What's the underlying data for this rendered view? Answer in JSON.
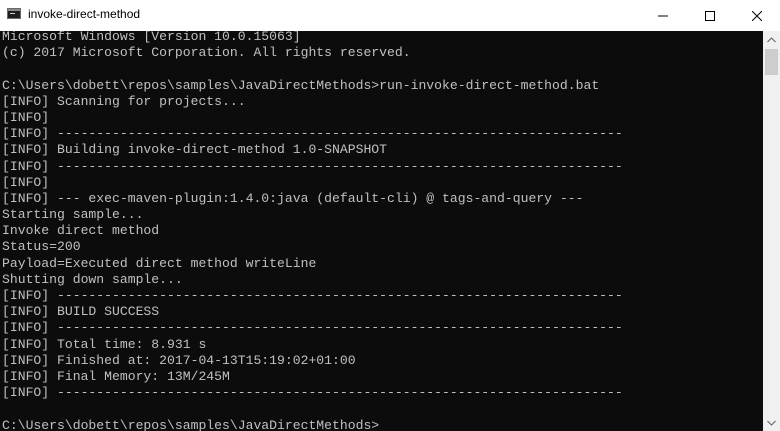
{
  "window": {
    "title": "invoke-direct-method",
    "icon": "console-icon",
    "controls": [
      "minimize-icon",
      "maximize-icon",
      "close-icon"
    ]
  },
  "console": {
    "lines": [
      "Microsoft Windows [Version 10.0.15063]",
      "(c) 2017 Microsoft Corporation. All rights reserved.",
      "",
      "C:\\Users\\dobett\\repos\\samples\\JavaDirectMethods>run-invoke-direct-method.bat",
      "[INFO] Scanning for projects...",
      "[INFO]",
      "[INFO] ------------------------------------------------------------------------",
      "[INFO] Building invoke-direct-method 1.0-SNAPSHOT",
      "[INFO] ------------------------------------------------------------------------",
      "[INFO]",
      "[INFO] --- exec-maven-plugin:1.4.0:java (default-cli) @ tags-and-query ---",
      "Starting sample...",
      "Invoke direct method",
      "Status=200",
      "Payload=Executed direct method writeLine",
      "Shutting down sample...",
      "[INFO] ------------------------------------------------------------------------",
      "[INFO] BUILD SUCCESS",
      "[INFO] ------------------------------------------------------------------------",
      "[INFO] Total time: 8.931 s",
      "[INFO] Finished at: 2017-04-13T15:19:02+01:00",
      "[INFO] Final Memory: 13M/245M",
      "[INFO] ------------------------------------------------------------------------",
      "",
      "C:\\Users\\dobett\\repos\\samples\\JavaDirectMethods>"
    ],
    "text_color": "#c0c0c0",
    "background": "#0c0c0c"
  },
  "scrollbar": {
    "position": 0
  }
}
